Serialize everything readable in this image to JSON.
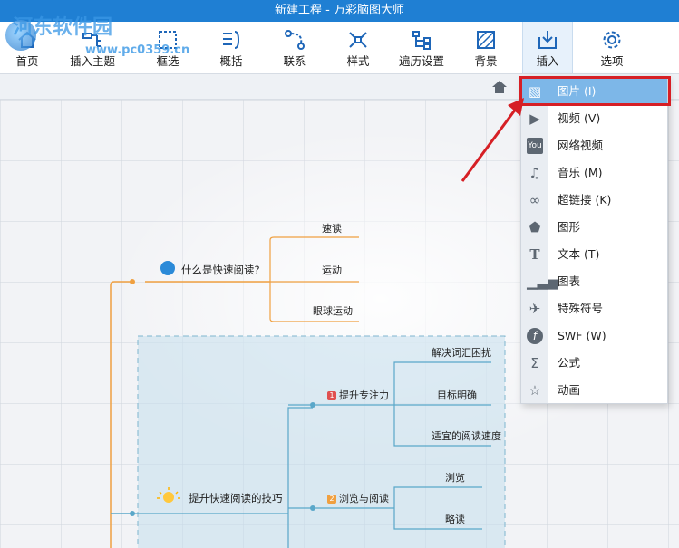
{
  "window": {
    "title": "新建工程 - 万彩脑图大师"
  },
  "watermark": {
    "site": "河东软件园",
    "url": "www.pc0359.cn"
  },
  "toolbar": {
    "items": [
      {
        "label": "首页",
        "icon": "home-icon"
      },
      {
        "label": "插入主题",
        "icon": "insert-topic-icon"
      },
      {
        "label": "框选",
        "icon": "select-box-icon"
      },
      {
        "label": "概括",
        "icon": "summary-icon"
      },
      {
        "label": "联系",
        "icon": "relation-icon"
      },
      {
        "label": "样式",
        "icon": "style-icon"
      },
      {
        "label": "遍历设置",
        "icon": "traverse-icon"
      },
      {
        "label": "背景",
        "icon": "background-icon"
      },
      {
        "label": "插入",
        "icon": "insert-icon"
      },
      {
        "label": "选项",
        "icon": "gear-icon"
      }
    ]
  },
  "insert_menu": {
    "items": [
      {
        "label": "图片 (I)",
        "icon": "image-icon"
      },
      {
        "label": "视频 (V)",
        "icon": "video-icon"
      },
      {
        "label": "网络视频",
        "icon": "youtube-icon"
      },
      {
        "label": "音乐 (M)",
        "icon": "music-icon"
      },
      {
        "label": "超链接 (K)",
        "icon": "link-icon"
      },
      {
        "label": "图形",
        "icon": "shape-icon"
      },
      {
        "label": "文本 (T)",
        "icon": "text-icon"
      },
      {
        "label": "图表",
        "icon": "chart-icon"
      },
      {
        "label": "特殊符号",
        "icon": "airplane-icon"
      },
      {
        "label": "SWF (W)",
        "icon": "flash-icon"
      },
      {
        "label": "公式",
        "icon": "sigma-icon"
      },
      {
        "label": "动画",
        "icon": "animation-icon"
      }
    ],
    "selected": "图片 (I)"
  },
  "mindmap": {
    "topic1": {
      "label": "什么是快速阅读?",
      "children": [
        "速读",
        "运动",
        "眼球运动"
      ]
    },
    "topic2": {
      "label": "提升快速阅读的技巧",
      "children": [
        {
          "label": "提升专注力",
          "badge": "1",
          "children": [
            "解决词汇困扰",
            "目标明确",
            "适宜的阅读速度"
          ]
        },
        {
          "label": "浏览与阅读",
          "badge": "2",
          "children": [
            "浏览",
            "略读"
          ]
        }
      ]
    }
  },
  "colors": {
    "titlebar": "#1f7fd3",
    "accent_orange": "#f0a040",
    "accent_blue": "#5aa7c9",
    "menu_selected": "#7db7e8",
    "highlight_red": "#d61f25"
  }
}
